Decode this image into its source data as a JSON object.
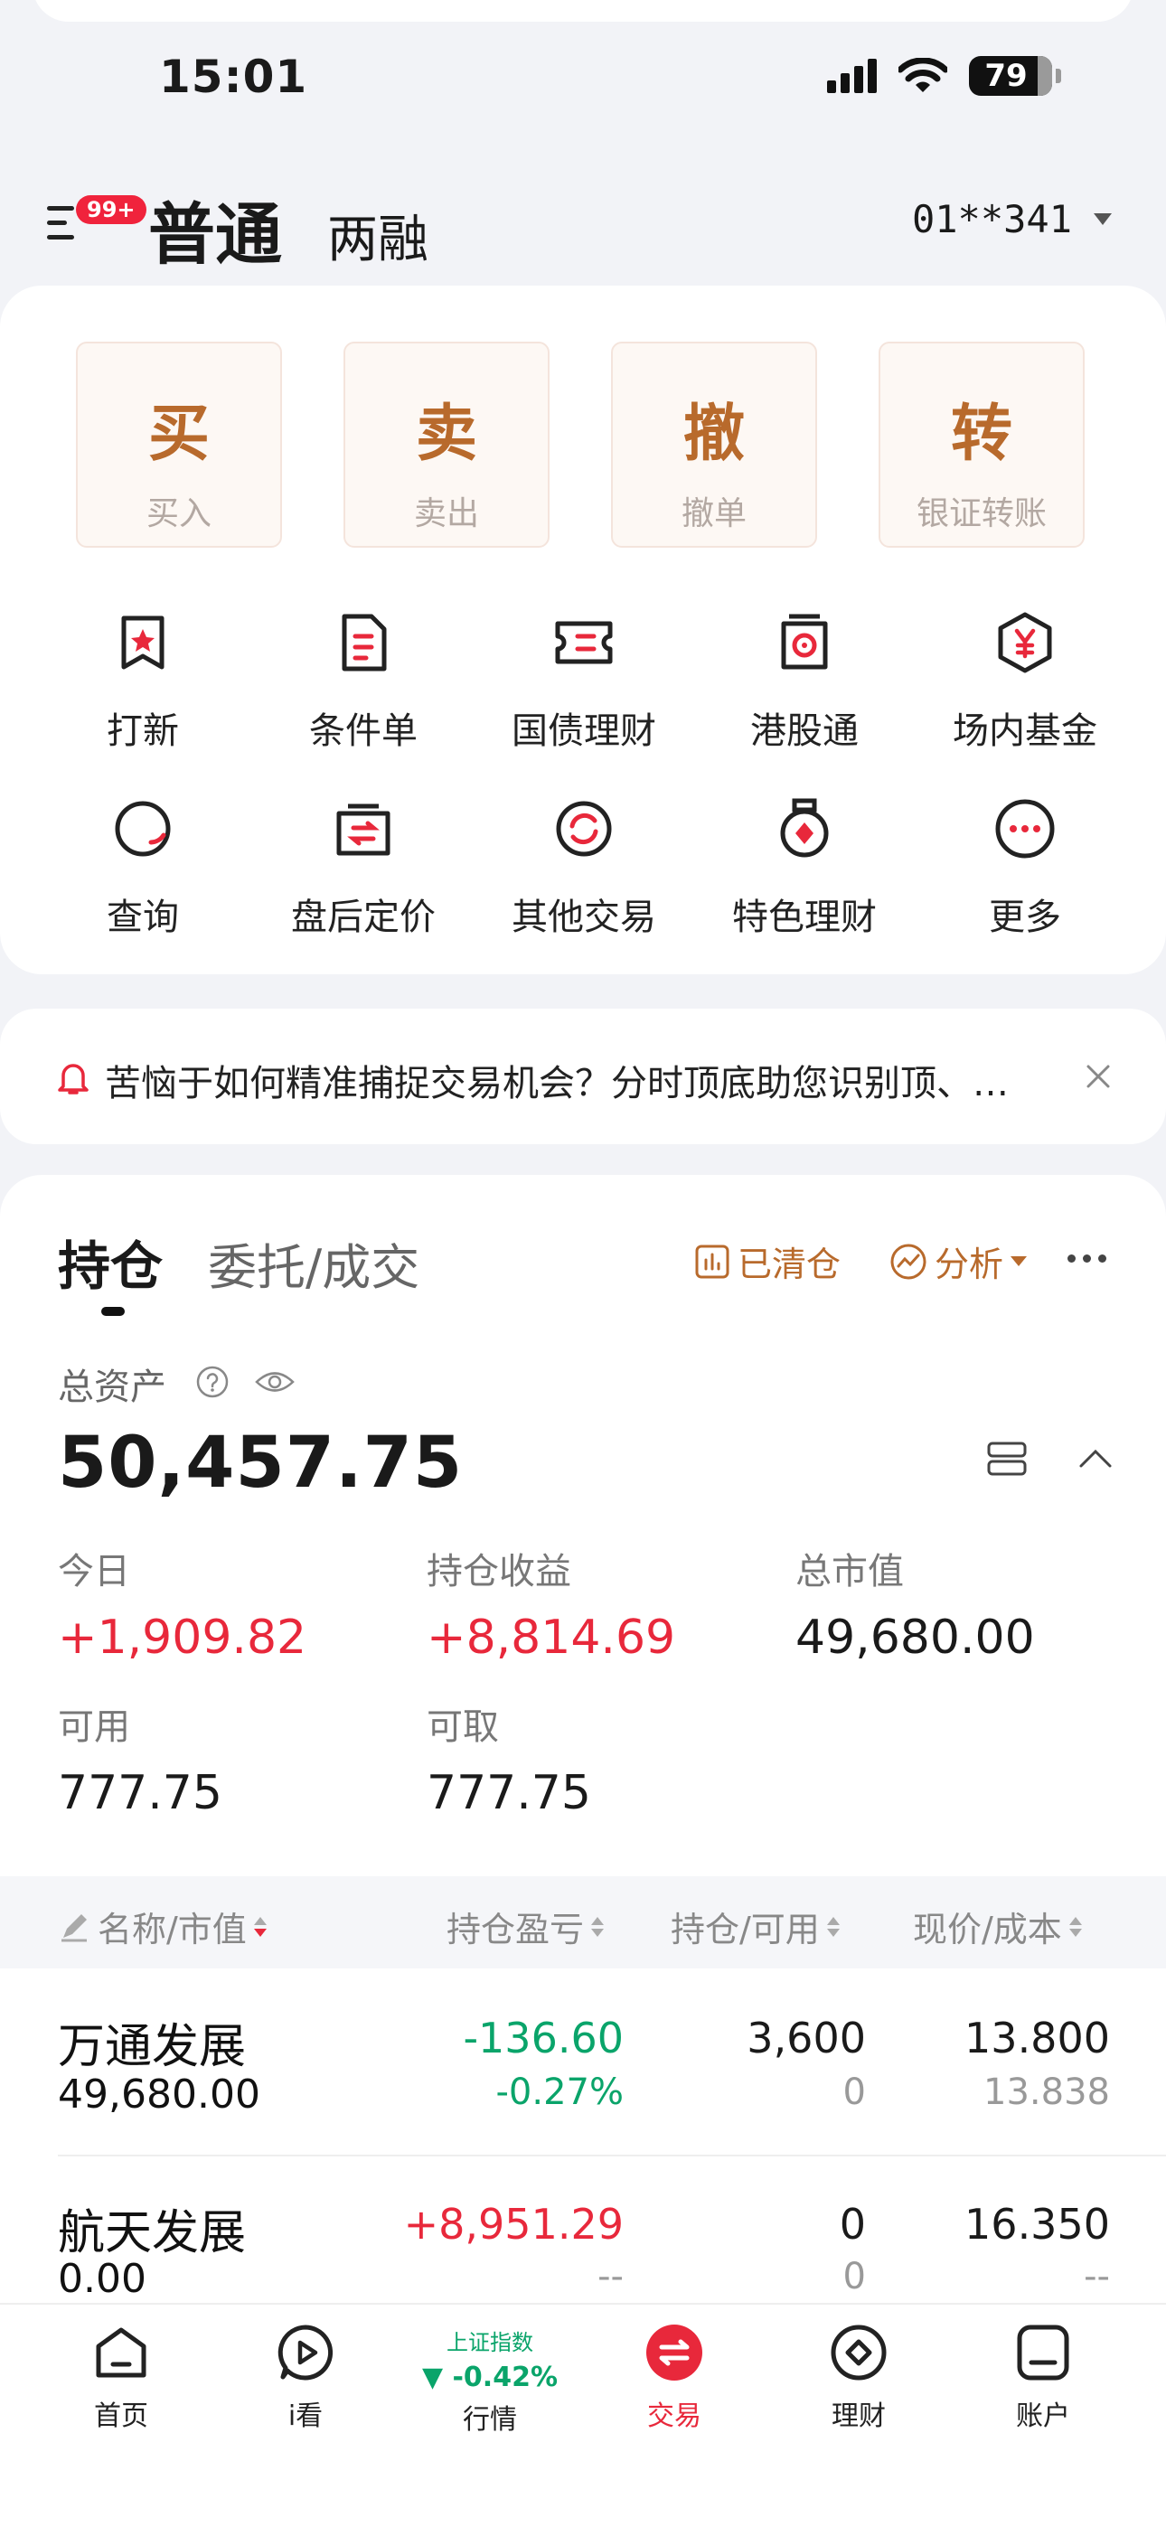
{
  "status_bar": {
    "time": "15:01",
    "battery": "79"
  },
  "header": {
    "badge": "99+",
    "title": "普通",
    "subtitle": "两融",
    "account": "01**341"
  },
  "quick_actions": [
    {
      "big": "买",
      "small": "买入"
    },
    {
      "big": "卖",
      "small": "卖出"
    },
    {
      "big": "撤",
      "small": "撤单"
    },
    {
      "big": "转",
      "small": "银证转账"
    }
  ],
  "grid": [
    {
      "label": "打新",
      "icon": "ribbon-star-icon"
    },
    {
      "label": "条件单",
      "icon": "document-icon"
    },
    {
      "label": "国债理财",
      "icon": "ticket-icon"
    },
    {
      "label": "港股通",
      "icon": "hk-flower-icon"
    },
    {
      "label": "场内基金",
      "icon": "yen-hexagon-icon"
    },
    {
      "label": "查询",
      "icon": "search-icon"
    },
    {
      "label": "盘后定价",
      "icon": "exchange-box-icon"
    },
    {
      "label": "其他交易",
      "icon": "refresh-circle-icon"
    },
    {
      "label": "特色理财",
      "icon": "medal-icon"
    },
    {
      "label": "更多",
      "icon": "more-icon"
    }
  ],
  "notice": {
    "text": "苦恼于如何精准捕捉交易机会？分时顶底助您识别顶、…"
  },
  "holdings": {
    "tab_active": "持仓",
    "tab_other": "委托/成交",
    "cleared": "已清仓",
    "analysis": "分析",
    "total_label": "总资产",
    "total_value": "50,457.75",
    "today_label": "今日",
    "today_value": "+1,909.82",
    "profit_label": "持仓收益",
    "profit_value": "+8,814.69",
    "market_label": "总市值",
    "market_value": "49,680.00",
    "avail_label": "可用",
    "avail_value": "777.75",
    "withdraw_label": "可取",
    "withdraw_value": "777.75",
    "columns": [
      "名称/市值",
      "持仓盈亏",
      "持仓/可用",
      "现价/成本"
    ],
    "rows": [
      {
        "name": "万通发展",
        "value": "49,680.00",
        "pl": "-136.60",
        "pl_pct": "-0.27%",
        "qty": "3,600",
        "avail": "0",
        "price": "13.800",
        "cost": "13.838"
      },
      {
        "name": "航天发展",
        "value": "0.00",
        "pl": "+8,951.29",
        "pl_pct": "--",
        "qty": "0",
        "avail": "0",
        "price": "16.350",
        "cost": "--"
      }
    ]
  },
  "tabbar": {
    "items": [
      "首页",
      "i看",
      "行情",
      "交易",
      "理财",
      "账户"
    ],
    "index_name": "上证指数",
    "index_change": "▼ -0.42%"
  },
  "colors": {
    "accent": "#b86a2c",
    "up": "#e8283b",
    "down": "#0aa46a",
    "active_tab": "#e8283b"
  }
}
